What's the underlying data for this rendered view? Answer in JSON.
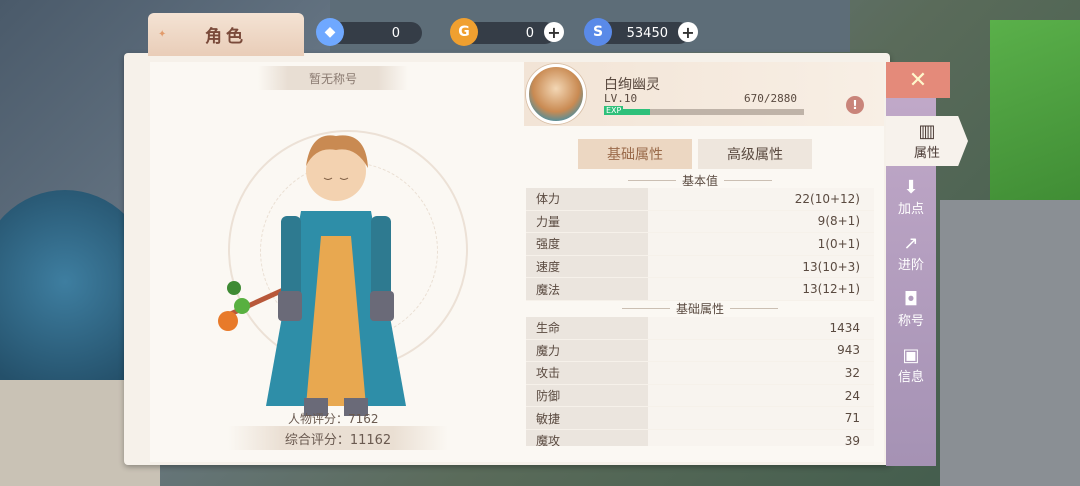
{
  "window_tab": {
    "label": "角色"
  },
  "resources": [
    {
      "icon": "crystal-icon",
      "value": "0",
      "color": "#6fa8ff",
      "has_plus": false
    },
    {
      "icon": "gold-coin-icon",
      "value": "0",
      "color": "#f0a030",
      "has_plus": true
    },
    {
      "icon": "silver-coin-icon",
      "value": "53450",
      "color": "#5a8ae8",
      "has_plus": true
    }
  ],
  "character": {
    "title": "暂无称号",
    "name": "白绚幽灵",
    "level": "LV.10",
    "exp_label": "EXP",
    "exp_text": "670/2880",
    "exp_fraction": 0.23,
    "char_score": "人物评分：7162",
    "total_score": "综合评分：11162"
  },
  "tabs": {
    "basic": "基础属性",
    "advanced": "高级属性"
  },
  "base_section": {
    "header": "基本值",
    "rows": [
      {
        "label": "体力",
        "value": "22",
        "extra": "(10+12)"
      },
      {
        "label": "力量",
        "value": "9",
        "extra": "(8+1)"
      },
      {
        "label": "强度",
        "value": "1",
        "extra": "(0+1)"
      },
      {
        "label": "速度",
        "value": "13",
        "extra": "(10+3)"
      },
      {
        "label": "魔法",
        "value": "13",
        "extra": "(12+1)"
      }
    ]
  },
  "attr_section": {
    "header": "基础属性",
    "rows": [
      {
        "label": "生命",
        "value": "1434"
      },
      {
        "label": "魔力",
        "value": "943"
      },
      {
        "label": "攻击",
        "value": "32"
      },
      {
        "label": "防御",
        "value": "24"
      },
      {
        "label": "敏捷",
        "value": "71"
      },
      {
        "label": "魔攻",
        "value": "39"
      }
    ]
  },
  "sidebar": {
    "close_icon": "close-icon",
    "items": [
      {
        "label": "属性",
        "icon": "bar-chart-icon",
        "active": true
      },
      {
        "label": "加点",
        "icon": "inbox-icon",
        "active": false
      },
      {
        "label": "进阶",
        "icon": "trend-up-icon",
        "active": false
      },
      {
        "label": "称号",
        "icon": "bag-icon",
        "active": false
      },
      {
        "label": "信息",
        "icon": "id-card-icon",
        "active": false
      }
    ]
  }
}
